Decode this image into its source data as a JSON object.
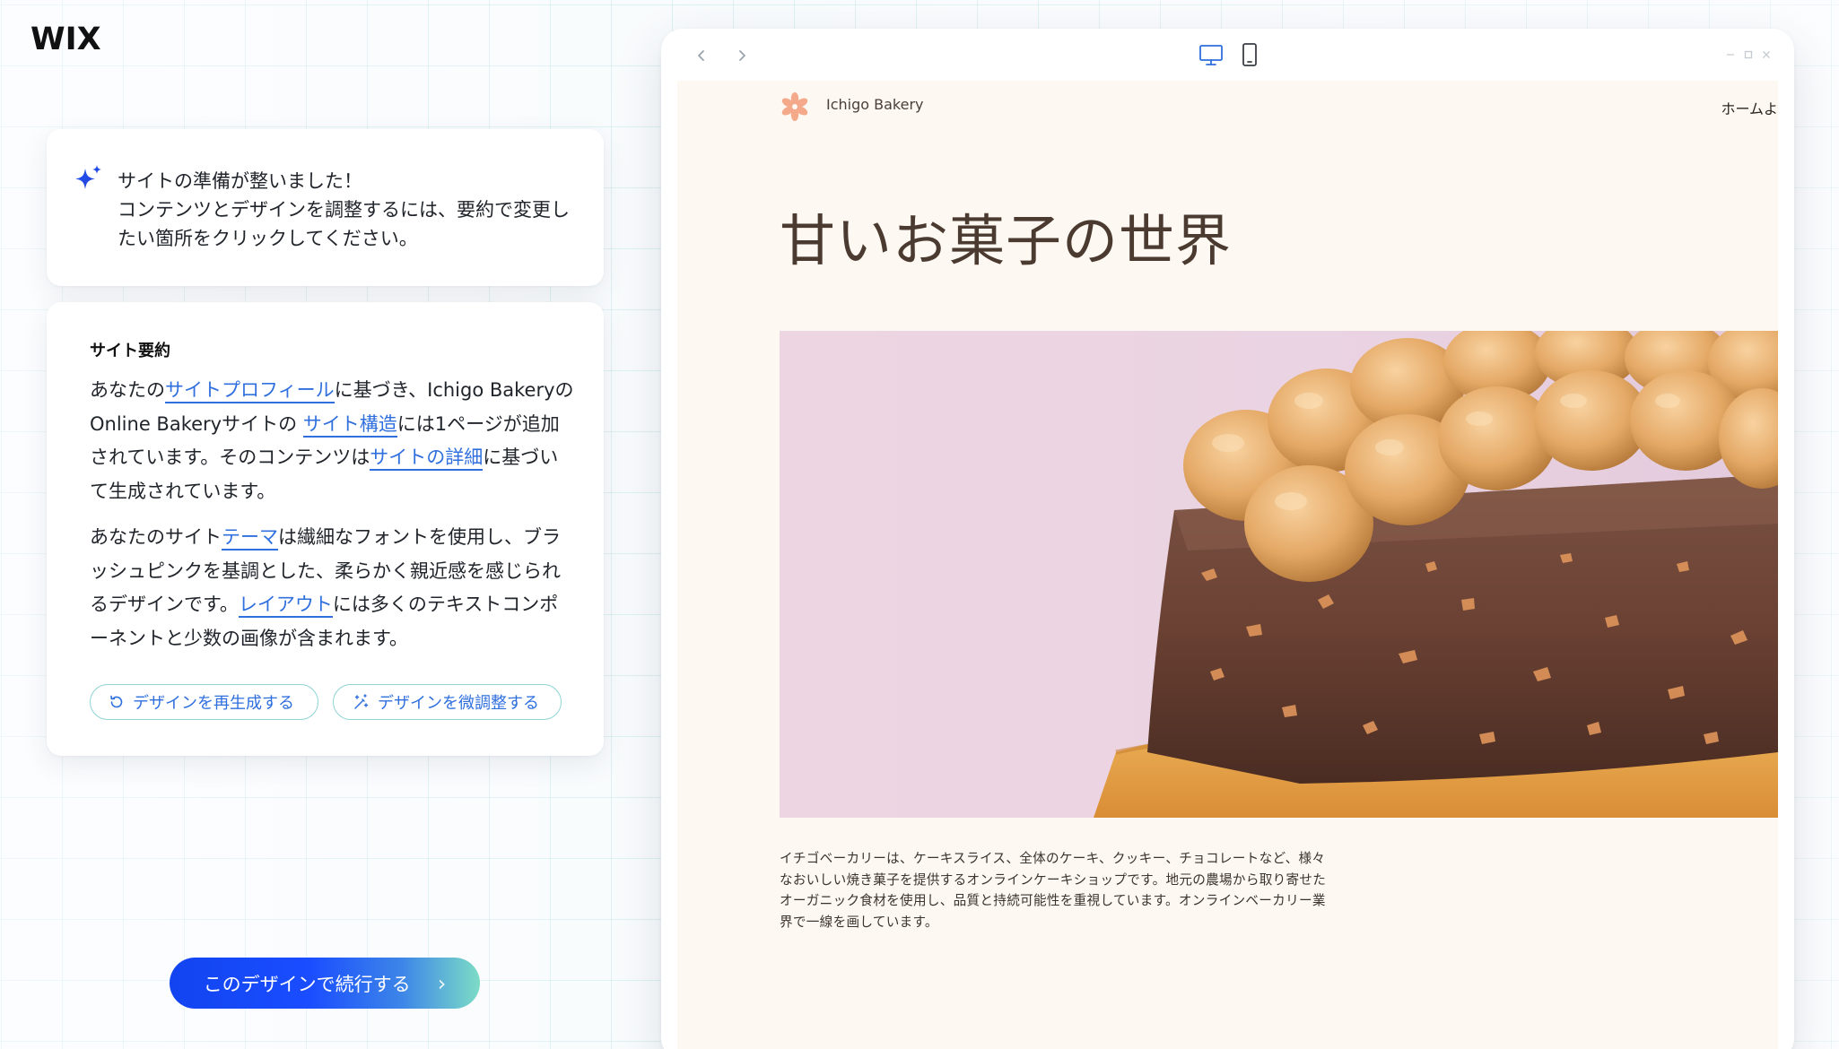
{
  "app": {
    "logo": "WIX"
  },
  "assistant": {
    "message": "サイトの準備が整いました！\nコンテンツとデザインを調整するには、要約で変更したい箇所をクリックしてください。"
  },
  "summary": {
    "title": "サイト要約",
    "p1": {
      "t1": "あなたの",
      "l1": "サイトプロフィール",
      "t2": "に基づき、Ichigo BakeryのOnline Bakeryサイトの ",
      "l2": "サイト構造",
      "t3": "には1ページが追加されています。そのコンテンツは",
      "l3": "サイトの詳細",
      "t4": "に基づいて生成されています。"
    },
    "p2": {
      "t1": "あなたのサイト",
      "l1": "テーマ",
      "t2": "は繊細なフォントを使用し、ブラッシュピンクを基調とした、柔らかく親近感を感じられるデザインです。",
      "l2": "レイアウト",
      "t3": "には多くのテキストコンポーネントと少数の画像が含まれます。"
    },
    "buttons": {
      "regenerate": "デザインを再生成する",
      "fine_tune": "デザインを微調整する"
    }
  },
  "cta": {
    "label": "このデザインで続行する"
  },
  "browser": {
    "icons": [
      "chevron-left-icon",
      "chevron-right-icon",
      "desktop-icon",
      "mobile-icon",
      "minimize-icon",
      "maximize-icon",
      "close-icon"
    ],
    "active_device": "desktop"
  },
  "site": {
    "name": "Ichigo Bakery",
    "nav": "ホームよ",
    "hero_title": "甘いお菓子の世界",
    "description": "イチゴベーカリーは、ケーキスライス、全体のケーキ、クッキー、チョコレートなど、様々なおいしい焼き菓子を提供するオンラインケーキショップです。地元の農場から取り寄せたオーガニック食材を使用し、品質と持続可能性を重視しています。オンラインベーカリー業界で一線を画しています。"
  },
  "colors": {
    "accent": "#2f6fde",
    "cta_start": "#1244f0",
    "cta_end": "#7cdcc6",
    "site_bg": "#fdf8f2",
    "hero_bg": "#efd7e4",
    "logo_flower": "#f4a98a"
  }
}
